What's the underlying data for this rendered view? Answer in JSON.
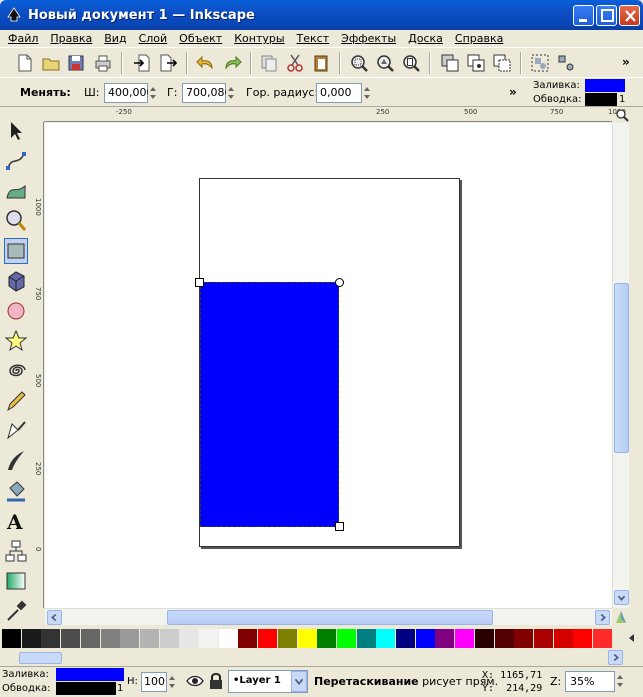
{
  "window": {
    "title": "Новый документ 1 — Inkscape"
  },
  "menu": [
    {
      "label": "Файл",
      "hotkey_index": 0
    },
    {
      "label": "Правка",
      "hotkey_index": 0
    },
    {
      "label": "Вид",
      "hotkey_index": 0
    },
    {
      "label": "Слой",
      "hotkey_index": 0
    },
    {
      "label": "Объект",
      "hotkey_index": 0
    },
    {
      "label": "Контуры",
      "hotkey_index": 0
    },
    {
      "label": "Текст",
      "hotkey_index": 0
    },
    {
      "label": "Эффекты",
      "hotkey_index": 0
    },
    {
      "label": "Доска",
      "hotkey_index": 0
    },
    {
      "label": "Справка",
      "hotkey_index": 0
    }
  ],
  "toolbar": {
    "overflow": "»"
  },
  "tool_controls": {
    "mode_label": "Менять:",
    "width_label": "Ш:",
    "width_value": "400,000",
    "height_label": "Г:",
    "height_value": "700,086",
    "radius_label": "Гор. радиус:",
    "radius_value": "0,000",
    "overflow": "»"
  },
  "fill_stroke_top": {
    "fill_label": "Заливка:",
    "stroke_label": "Обводка:",
    "fill_color": "#0000ff",
    "stroke_color": "#000000",
    "stroke_width": "1"
  },
  "rulers": {
    "horizontal": [
      "-250",
      "250",
      "500",
      "750",
      "1000"
    ],
    "vertical": [
      "1000",
      "750",
      "500",
      "250",
      "0"
    ]
  },
  "palette": [
    "#000000",
    "#1a1a1a",
    "#333333",
    "#4d4d4d",
    "#666666",
    "#808080",
    "#999999",
    "#b3b3b3",
    "#cccccc",
    "#e6e6e6",
    "#f2f2f2",
    "#ffffff",
    "#800000",
    "#ff0000",
    "#808000",
    "#ffff00",
    "#008000",
    "#00ff00",
    "#008080",
    "#00ffff",
    "#000080",
    "#0000ff",
    "#800080",
    "#ff00ff",
    "#2b0000",
    "#550000",
    "#800000",
    "#aa0000",
    "#d40000",
    "#ff0000",
    "#ff2a2a"
  ],
  "status": {
    "fill_label": "Заливка:",
    "stroke_label": "Обводка:",
    "fill_color": "#0000ff",
    "stroke_color": "#000000",
    "stroke_width": "1",
    "opacity_label": "Н:",
    "opacity_value": "100",
    "layer": "•Layer 1",
    "message_bold": "Перетаскивание",
    "message_rest": " рисует прям.",
    "x_label": "X:",
    "x_value": "1165,71",
    "y_label": "Y:",
    "y_value": "214,29",
    "zoom_label": "Z:",
    "zoom_value": "35%"
  }
}
